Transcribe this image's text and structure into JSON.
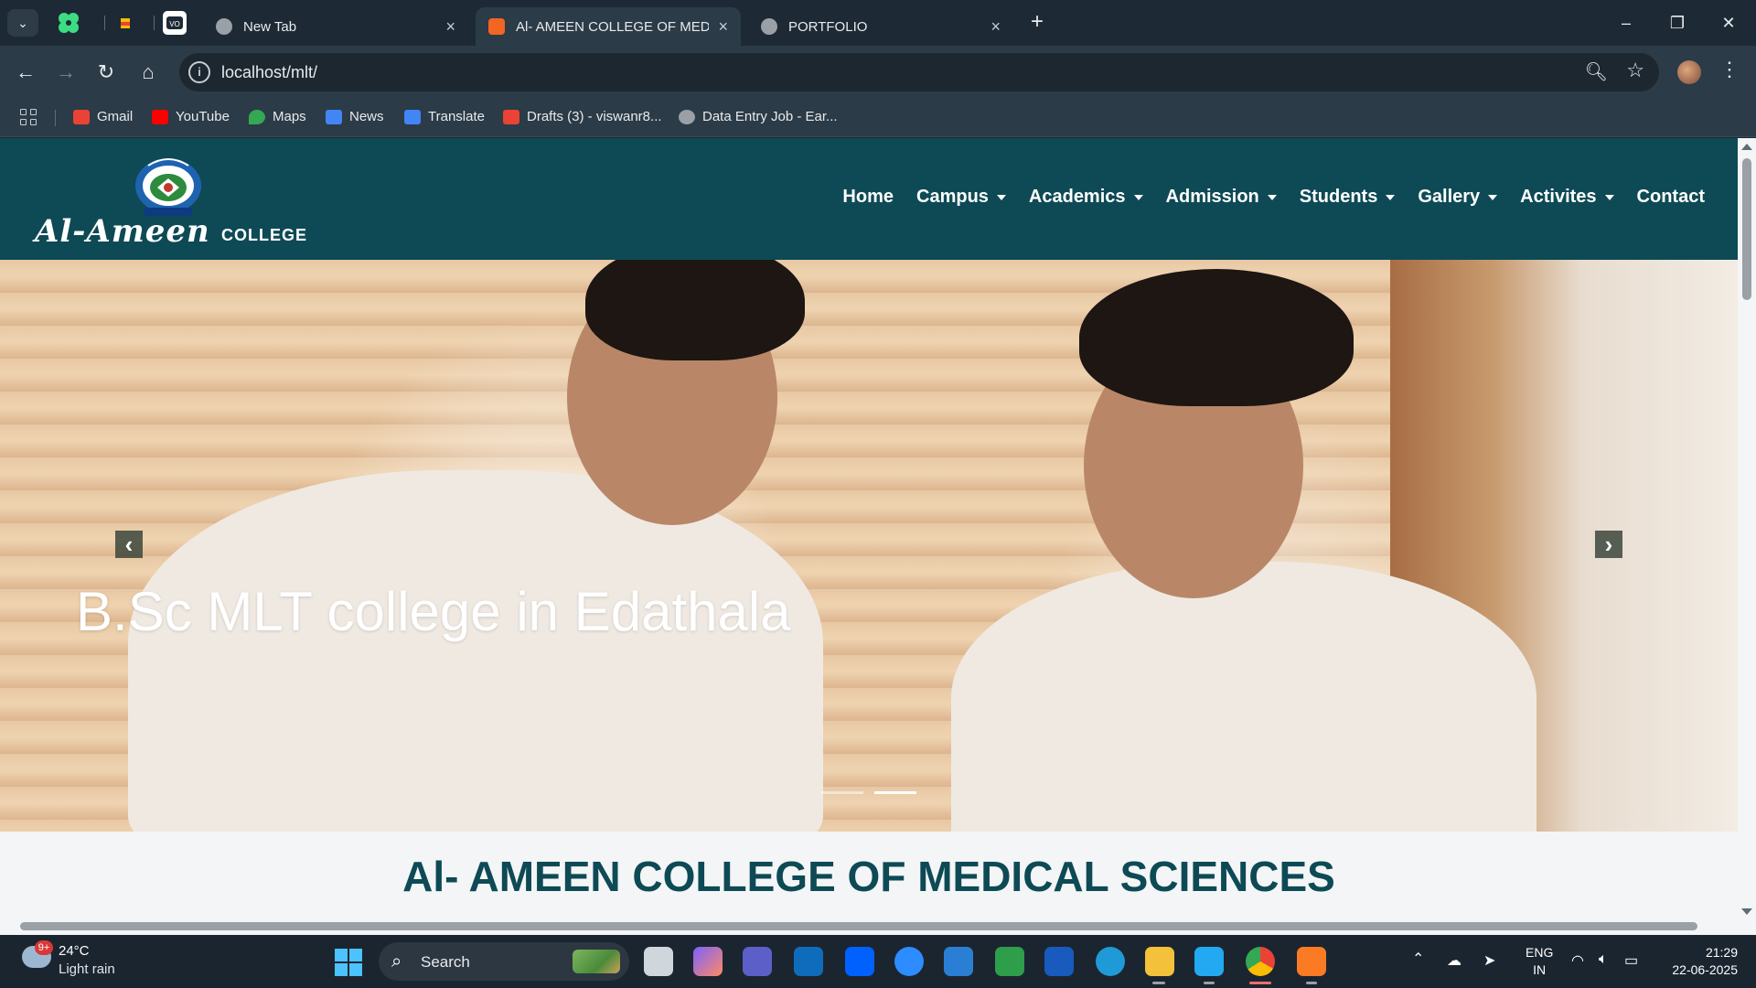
{
  "browser": {
    "tabs": [
      {
        "title": "New Tab",
        "active": false,
        "favicon_color": "#9aa0a6"
      },
      {
        "title": "Al- AMEEN COLLEGE OF MEDIC",
        "active": true,
        "favicon_color": "#f26522"
      },
      {
        "title": "PORTFOLIO",
        "active": false,
        "favicon_color": "#9aa0a6"
      }
    ],
    "pinned_icons": [
      "clover-app-icon",
      "colorful-app-icon",
      "video-app-icon"
    ],
    "address": "localhost/mlt/",
    "bookmarks": [
      {
        "label": "Gmail",
        "icon": "gmail-icon",
        "color": "#ea4335"
      },
      {
        "label": "YouTube",
        "icon": "youtube-icon",
        "color": "#ff0000"
      },
      {
        "label": "Maps",
        "icon": "maps-icon",
        "color": "#34a853"
      },
      {
        "label": "News",
        "icon": "news-icon",
        "color": "#4285f4"
      },
      {
        "label": "Translate",
        "icon": "translate-icon",
        "color": "#4285f4"
      },
      {
        "label": "Drafts (3) - viswanr8...",
        "icon": "gmail-icon",
        "color": "#ea4335"
      },
      {
        "label": "Data Entry Job - Ear...",
        "icon": "globe-icon",
        "color": "#9aa0a6"
      }
    ]
  },
  "site": {
    "logo_text": "Al-Ameen",
    "logo_sub": "COLLEGE",
    "emblem_caption": "AL-AMEEN COLLEGE",
    "nav": [
      {
        "label": "Home",
        "dropdown": false
      },
      {
        "label": "Campus",
        "dropdown": true
      },
      {
        "label": "Academics",
        "dropdown": true
      },
      {
        "label": "Admission",
        "dropdown": true
      },
      {
        "label": "Students",
        "dropdown": true
      },
      {
        "label": "Gallery",
        "dropdown": true
      },
      {
        "label": "Activites",
        "dropdown": true
      },
      {
        "label": "Contact",
        "dropdown": false
      }
    ],
    "hero": {
      "caption": "B.Sc MLT college in Edathala",
      "prev_glyph": "‹",
      "next_glyph": "›",
      "slides": 2,
      "active_slide": 2
    },
    "section_title": "Al- AMEEN COLLEGE OF MEDICAL SCIENCES",
    "colors": {
      "header_bg": "#0d4a55",
      "title": "#0d4a55"
    }
  },
  "taskbar": {
    "weather_temp": "24°C",
    "weather_desc": "Light rain",
    "weather_badge": "9+",
    "search_label": "Search",
    "apps": [
      {
        "name": "task-view",
        "color": "#cfd6dc"
      },
      {
        "name": "copilot",
        "color": "#7b61ff"
      },
      {
        "name": "teams",
        "color": "#5b5fc7"
      },
      {
        "name": "outlook",
        "color": "#0f6cbd"
      },
      {
        "name": "dropbox",
        "color": "#0061fe"
      },
      {
        "name": "zoom",
        "color": "#2d8cff"
      },
      {
        "name": "remote-desktop",
        "color": "#2a7fd4"
      },
      {
        "name": "solitaire",
        "color": "#2e9e4a"
      },
      {
        "name": "word",
        "color": "#185abd"
      },
      {
        "name": "edge",
        "color": "#1f9ad6"
      },
      {
        "name": "file-explorer",
        "color": "#f3c13a"
      },
      {
        "name": "vscode",
        "color": "#23a9f2"
      },
      {
        "name": "chrome",
        "color": "#e84335"
      },
      {
        "name": "xampp",
        "color": "#fb7a24"
      }
    ],
    "lang_line1": "ENG",
    "lang_line2": "IN",
    "time": "21:29",
    "date": "22-06-2025"
  }
}
